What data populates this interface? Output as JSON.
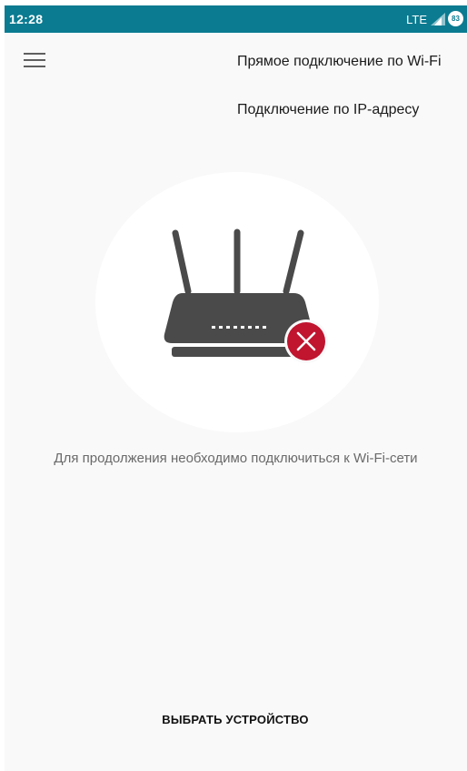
{
  "status_bar": {
    "time": "12:28",
    "network": "LTE",
    "battery": "83",
    "background_color": "#0a7b91"
  },
  "header": {
    "menu_icon": "hamburger-menu-icon"
  },
  "menu": {
    "items": [
      {
        "label": "Прямое подключение по Wi-Fi"
      },
      {
        "label": "Подключение по IP-адресу"
      }
    ]
  },
  "illustration": {
    "icon": "router-disconnected-icon",
    "error_badge_color": "#c0142f",
    "router_color": "#4a4a4a"
  },
  "message": {
    "text": "Для продолжения необходимо подключиться к Wi-Fi-сети"
  },
  "action": {
    "select_device_label": "ВЫБРАТЬ УСТРОЙСТВО"
  }
}
